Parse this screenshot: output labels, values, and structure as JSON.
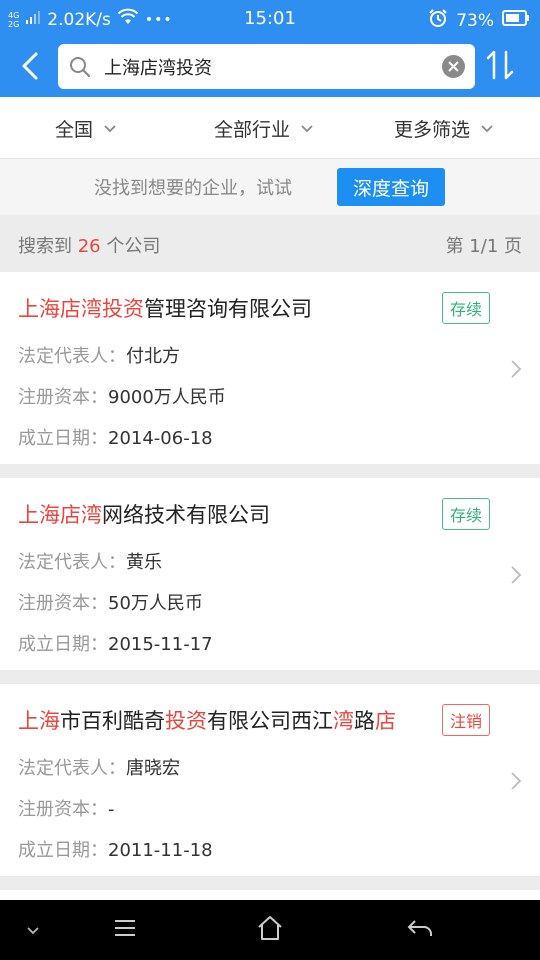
{
  "status_bar": {
    "network_top": "4G",
    "network_bottom": "2G",
    "speed": "2.02K/s",
    "more": "•••",
    "time": "15:01",
    "battery": "73%"
  },
  "search": {
    "value": "上海店湾投资"
  },
  "filters": {
    "region": "全国",
    "industry": "全部行业",
    "more": "更多筛选"
  },
  "deep_query": {
    "tip": "没找到想要的企业，试试",
    "button": "深度查询"
  },
  "summary": {
    "prefix": "搜索到 ",
    "count": "26",
    "suffix": " 个公司",
    "page": "第 1/1 页"
  },
  "labels": {
    "rep": "法定代表人：",
    "capital": "注册资本：",
    "date": "成立日期："
  },
  "results": [
    {
      "title_parts": [
        {
          "text": "上海店湾投资",
          "hl": true
        },
        {
          "text": "管理咨询有限公司",
          "hl": false
        }
      ],
      "status": "存续",
      "status_type": "active",
      "rep": "付北方",
      "capital": "9000万人民币",
      "date": "2014-06-18"
    },
    {
      "title_parts": [
        {
          "text": "上海店湾",
          "hl": true
        },
        {
          "text": "网络技术有限公司",
          "hl": false
        }
      ],
      "status": "存续",
      "status_type": "active",
      "rep": "黄乐",
      "capital": "50万人民币",
      "date": "2015-11-17"
    },
    {
      "title_parts": [
        {
          "text": "上海",
          "hl": true
        },
        {
          "text": "市百利酷奇",
          "hl": false
        },
        {
          "text": "投资",
          "hl": true
        },
        {
          "text": "有限公司西江",
          "hl": false
        },
        {
          "text": "湾",
          "hl": true
        },
        {
          "text": "路",
          "hl": false
        },
        {
          "text": "店",
          "hl": true
        }
      ],
      "status": "注销",
      "status_type": "cancel",
      "rep": "唐晓宏",
      "capital": "-",
      "date": "2011-11-18"
    }
  ],
  "colors": {
    "header_blue": "#2e8ff0",
    "highlight_red": "#e9463f",
    "active_green": "#2fb27a",
    "button_blue": "#1e8ff2"
  },
  "icons": [
    "back-arrow-icon",
    "search-icon",
    "clear-icon",
    "sort-icon",
    "chevron-down-icon",
    "chevron-right-icon",
    "wifi-icon",
    "alarm-icon",
    "battery-icon",
    "nav-down-icon",
    "nav-menu-icon",
    "nav-home-icon",
    "nav-back-icon"
  ]
}
